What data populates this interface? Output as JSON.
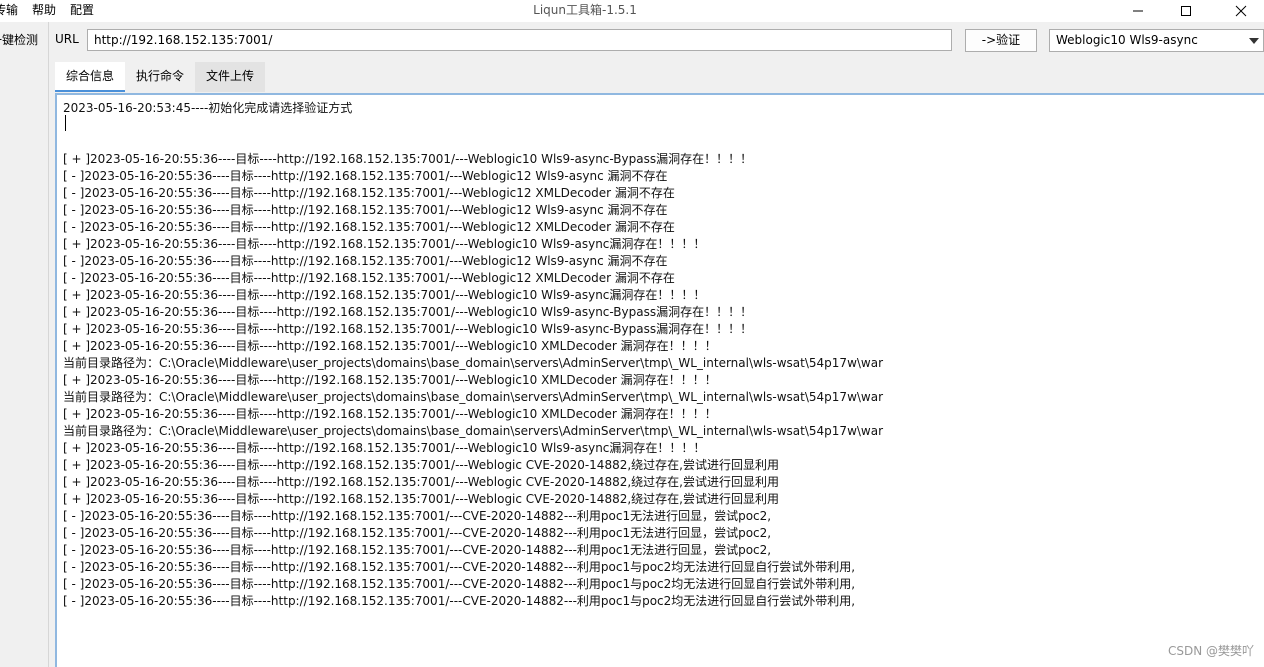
{
  "menu": {
    "items": [
      "传输",
      "帮助",
      "配置"
    ]
  },
  "window": {
    "title": "Liqun工具箱-1.5.1"
  },
  "left_strip": {
    "tab_label": "一键检测"
  },
  "url_bar": {
    "label": "URL",
    "value": "http://192.168.152.135:7001/",
    "verify_label": "->验证"
  },
  "exploit_select": {
    "selected": "Weblogic10 Wls9-async"
  },
  "tabs": [
    {
      "label": "综合信息"
    },
    {
      "label": "执行命令"
    },
    {
      "label": "文件上传"
    }
  ],
  "log": {
    "lines": [
      "2023-05-16-20:53:45----初始化完成请选择验证方式",
      "",
      "",
      "[ + ]2023-05-16-20:55:36----目标----http://192.168.152.135:7001/---Weblogic10 Wls9-async-Bypass漏洞存在！！！！",
      "[ - ]2023-05-16-20:55:36----目标----http://192.168.152.135:7001/---Weblogic12 Wls9-async 漏洞不存在",
      "[ - ]2023-05-16-20:55:36----目标----http://192.168.152.135:7001/---Weblogic12 XMLDecoder 漏洞不存在",
      "[ - ]2023-05-16-20:55:36----目标----http://192.168.152.135:7001/---Weblogic12 Wls9-async 漏洞不存在",
      "[ - ]2023-05-16-20:55:36----目标----http://192.168.152.135:7001/---Weblogic12 XMLDecoder 漏洞不存在",
      "[ + ]2023-05-16-20:55:36----目标----http://192.168.152.135:7001/---Weblogic10 Wls9-async漏洞存在！！！！",
      "[ - ]2023-05-16-20:55:36----目标----http://192.168.152.135:7001/---Weblogic12 Wls9-async 漏洞不存在",
      "[ - ]2023-05-16-20:55:36----目标----http://192.168.152.135:7001/---Weblogic12 XMLDecoder 漏洞不存在",
      "[ + ]2023-05-16-20:55:36----目标----http://192.168.152.135:7001/---Weblogic10 Wls9-async漏洞存在！！！！",
      "[ + ]2023-05-16-20:55:36----目标----http://192.168.152.135:7001/---Weblogic10 Wls9-async-Bypass漏洞存在！！！！",
      "[ + ]2023-05-16-20:55:36----目标----http://192.168.152.135:7001/---Weblogic10 Wls9-async-Bypass漏洞存在！！！！",
      "[ + ]2023-05-16-20:55:36----目标----http://192.168.152.135:7001/---Weblogic10 XMLDecoder 漏洞存在！！！！",
      "当前目录路径为：C:\\Oracle\\Middleware\\user_projects\\domains\\base_domain\\servers\\AdminServer\\tmp\\_WL_internal\\wls-wsat\\54p17w\\war",
      "[ + ]2023-05-16-20:55:36----目标----http://192.168.152.135:7001/---Weblogic10 XMLDecoder 漏洞存在！！！！",
      "当前目录路径为：C:\\Oracle\\Middleware\\user_projects\\domains\\base_domain\\servers\\AdminServer\\tmp\\_WL_internal\\wls-wsat\\54p17w\\war",
      "[ + ]2023-05-16-20:55:36----目标----http://192.168.152.135:7001/---Weblogic10 XMLDecoder 漏洞存在！！！！",
      "当前目录路径为：C:\\Oracle\\Middleware\\user_projects\\domains\\base_domain\\servers\\AdminServer\\tmp\\_WL_internal\\wls-wsat\\54p17w\\war",
      "[ + ]2023-05-16-20:55:36----目标----http://192.168.152.135:7001/---Weblogic10 Wls9-async漏洞存在！！！！",
      "[ + ]2023-05-16-20:55:36----目标----http://192.168.152.135:7001/---Weblogic CVE-2020-14882,绕过存在,尝试进行回显利用",
      "[ + ]2023-05-16-20:55:36----目标----http://192.168.152.135:7001/---Weblogic CVE-2020-14882,绕过存在,尝试进行回显利用",
      "[ + ]2023-05-16-20:55:36----目标----http://192.168.152.135:7001/---Weblogic CVE-2020-14882,绕过存在,尝试进行回显利用",
      "[ - ]2023-05-16-20:55:36----目标----http://192.168.152.135:7001/---CVE-2020-14882---利用poc1无法进行回显，尝试poc2,",
      "[ - ]2023-05-16-20:55:36----目标----http://192.168.152.135:7001/---CVE-2020-14882---利用poc1无法进行回显，尝试poc2,",
      "[ - ]2023-05-16-20:55:36----目标----http://192.168.152.135:7001/---CVE-2020-14882---利用poc1无法进行回显，尝试poc2,",
      "[ - ]2023-05-16-20:55:36----目标----http://192.168.152.135:7001/---CVE-2020-14882---利用poc1与poc2均无法进行回显自行尝试外带利用,",
      "[ - ]2023-05-16-20:55:36----目标----http://192.168.152.135:7001/---CVE-2020-14882---利用poc1与poc2均无法进行回显自行尝试外带利用,",
      "[ - ]2023-05-16-20:55:36----目标----http://192.168.152.135:7001/---CVE-2020-14882---利用poc1与poc2均无法进行回显自行尝试外带利用,"
    ]
  },
  "watermark": {
    "text": "CSDN @樊樊吖"
  },
  "icons": {
    "minimize": "minimize-icon",
    "maximize": "maximize-icon",
    "close": "close-icon",
    "dropdown": "chevron-down-icon"
  }
}
